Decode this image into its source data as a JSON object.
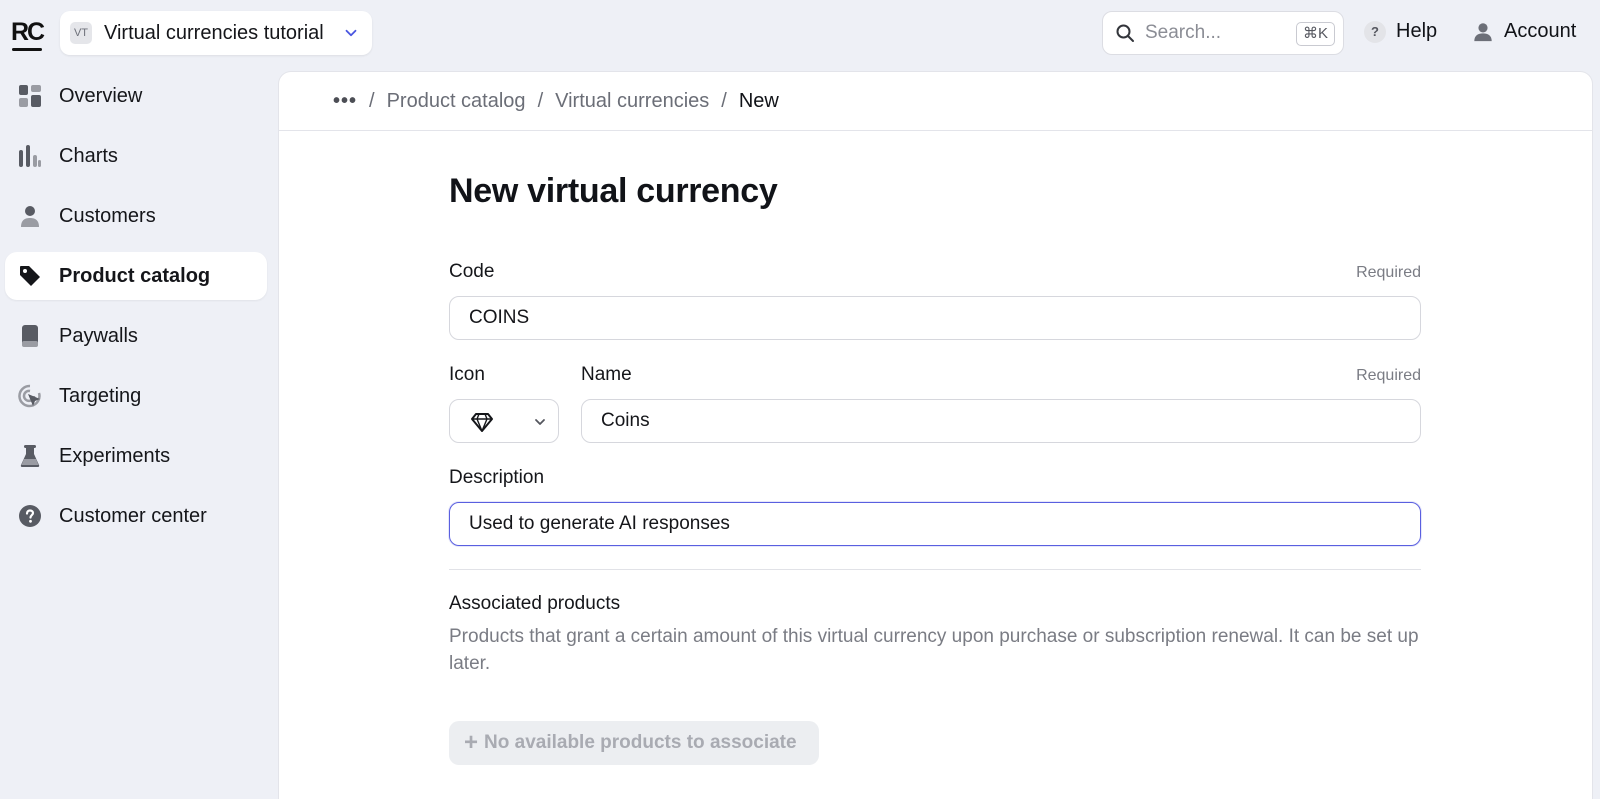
{
  "header": {
    "logo": "RC",
    "project": {
      "badge": "VT",
      "name": "Virtual currencies tutorial"
    },
    "search": {
      "placeholder": "Search...",
      "shortcut": "⌘K"
    },
    "help_label": "Help",
    "account_label": "Account"
  },
  "sidebar": {
    "items": [
      {
        "label": "Overview",
        "icon": "overview-icon"
      },
      {
        "label": "Charts",
        "icon": "charts-icon"
      },
      {
        "label": "Customers",
        "icon": "customers-icon"
      },
      {
        "label": "Product catalog",
        "icon": "tag-icon",
        "active": true
      },
      {
        "label": "Paywalls",
        "icon": "paywalls-icon"
      },
      {
        "label": "Targeting",
        "icon": "targeting-icon"
      },
      {
        "label": "Experiments",
        "icon": "flask-icon"
      },
      {
        "label": "Customer center",
        "icon": "question-icon"
      }
    ]
  },
  "breadcrumb": {
    "more": "•••",
    "items": [
      "Product catalog",
      "Virtual currencies"
    ],
    "current": "New",
    "separator": "/"
  },
  "form": {
    "title": "New virtual currency",
    "code": {
      "label": "Code",
      "required": "Required",
      "value": "COINS"
    },
    "icon": {
      "label": "Icon",
      "value": "diamond"
    },
    "name": {
      "label": "Name",
      "required": "Required",
      "value": "Coins"
    },
    "description": {
      "label": "Description",
      "value": "Used to generate AI responses"
    },
    "associated": {
      "title": "Associated products",
      "description": "Products that grant a certain amount of this virtual currency upon purchase or subscription renewal. It can be set up later.",
      "button": "No available products to associate"
    }
  },
  "colors": {
    "accent": "#5a5fe0",
    "background": "#eef0f6"
  }
}
